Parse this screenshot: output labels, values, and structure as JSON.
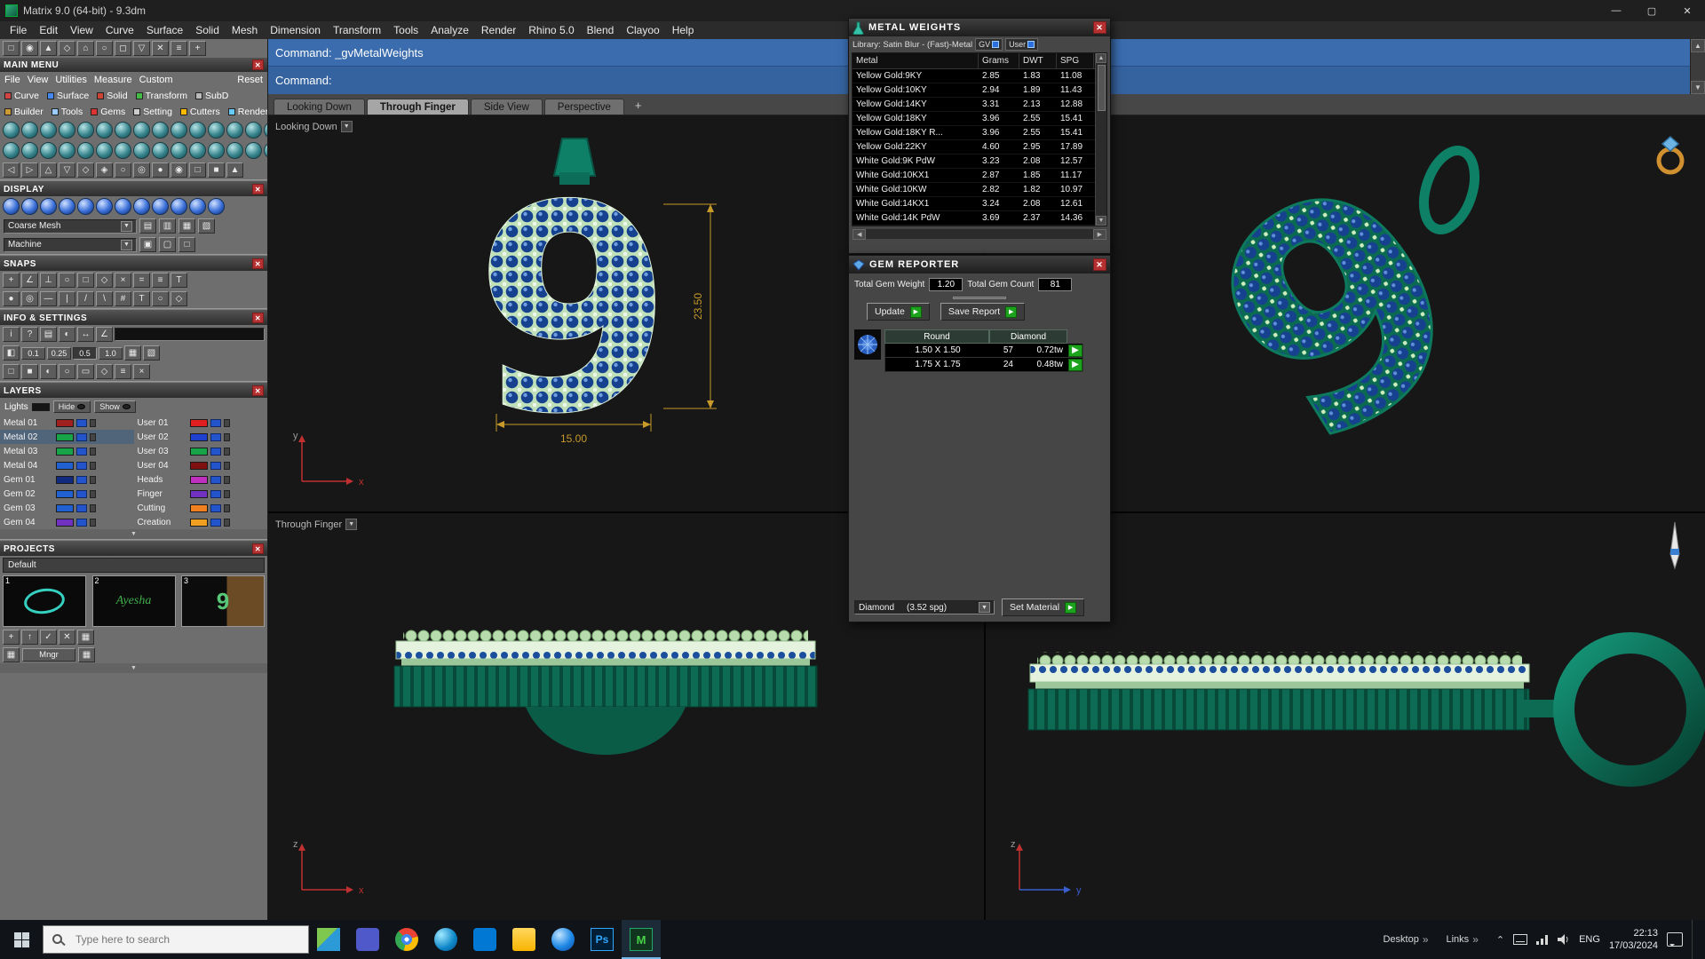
{
  "window": {
    "title": "Matrix 9.0 (64-bit) - 9.3dm"
  },
  "menu_bar": [
    "File",
    "Edit",
    "View",
    "Curve",
    "Surface",
    "Solid",
    "Mesh",
    "Dimension",
    "Transform",
    "Tools",
    "Analyze",
    "Render",
    "Rhino 5.0",
    "Blend",
    "Clayoo",
    "Help"
  ],
  "command": {
    "line1": "Command: _gvMetalWeights",
    "line2": "Command:"
  },
  "viewport_tabs": {
    "tabs": [
      "Looking Down",
      "Through Finger",
      "Side View",
      "Perspective"
    ],
    "active": "Through Finger"
  },
  "viewports": {
    "top_left": {
      "label": "Looking Down",
      "dim_height": "23.50",
      "dim_width": "15.00",
      "axes": [
        "y",
        "x"
      ]
    },
    "bottom_left": {
      "label": "Through Finger",
      "axes": [
        "z",
        "x"
      ]
    },
    "bottom_right": {
      "axes": [
        "z",
        "y"
      ]
    }
  },
  "left_panel": {
    "main_menu": {
      "title": "MAIN MENU",
      "menu_items": [
        "File",
        "View",
        "Utilities",
        "Measure",
        "Custom",
        "Reset"
      ],
      "shortcut_row1": [
        {
          "label": "Curve",
          "color": "#d04444"
        },
        {
          "label": "Surface",
          "color": "#4488ee"
        },
        {
          "label": "Solid",
          "color": "#cc4433"
        },
        {
          "label": "Transform",
          "color": "#44bb44"
        },
        {
          "label": "SubD",
          "color": "#bbbbbb"
        }
      ],
      "shortcut_row2": [
        {
          "label": "Builder",
          "color": "#cc9933"
        },
        {
          "label": "Tools",
          "color": "#99ccff"
        },
        {
          "label": "Gems",
          "color": "#dd3333"
        },
        {
          "label": "Setting",
          "color": "#cccccc"
        },
        {
          "label": "Cutters",
          "color": "#ffbb00"
        },
        {
          "label": "Render",
          "color": "#66ccff"
        }
      ]
    },
    "display": {
      "title": "DISPLAY",
      "mesh_dropdown": "Coarse Mesh",
      "machine_dropdown": "Machine"
    },
    "snaps": {
      "title": "SNAPS"
    },
    "info_settings": {
      "title": "INFO & SETTINGS",
      "snap_values": [
        "0.1",
        "0.25",
        "0.5",
        "1.0"
      ],
      "active_value": "0.5"
    },
    "layers": {
      "title": "LAYERS",
      "lights_label": "Lights",
      "hide_label": "Hide",
      "show_label": "Show",
      "selected": "Metal 02",
      "left": [
        {
          "label": "Metal 01",
          "color": "#a02020"
        },
        {
          "label": "Metal 02",
          "color": "#18a54a"
        },
        {
          "label": "Metal 03",
          "color": "#18a54a"
        },
        {
          "label": "Metal 04",
          "color": "#2060d0"
        },
        {
          "label": "Gem 01",
          "color": "#102a80"
        },
        {
          "label": "Gem 02",
          "color": "#2060d0"
        },
        {
          "label": "Gem 03",
          "color": "#2060d0"
        },
        {
          "label": "Gem 04",
          "color": "#7030c0"
        }
      ],
      "right": [
        {
          "label": "User 01",
          "color": "#e02020"
        },
        {
          "label": "User 02",
          "color": "#2040d0"
        },
        {
          "label": "User 03",
          "color": "#18a54a"
        },
        {
          "label": "User 04",
          "color": "#801010"
        },
        {
          "label": "Heads",
          "color": "#c030c0"
        },
        {
          "label": "Finger",
          "color": "#7030c0"
        },
        {
          "label": "Cutting",
          "color": "#f08020"
        },
        {
          "label": "Creation",
          "color": "#f0a020"
        }
      ]
    },
    "projects": {
      "title": "PROJECTS",
      "profile": "Default",
      "thumbs": [
        {
          "num": "1",
          "kind": "ellipse"
        },
        {
          "num": "2",
          "kind": "text",
          "text": "Ayesha"
        },
        {
          "num": "3",
          "kind": "pendant"
        }
      ],
      "mngr_label": "Mngr"
    }
  },
  "metal_weights": {
    "title": "METAL WEIGHTS",
    "library_label": "Library: Satin Blur - (Fast)-Metal",
    "gv_label": "GV",
    "user_label": "User",
    "columns": [
      "Metal",
      "Grams",
      "DWT",
      "SPG"
    ],
    "rows": [
      [
        "Yellow Gold:9KY",
        "2.85",
        "1.83",
        "11.08"
      ],
      [
        "Yellow Gold:10KY",
        "2.94",
        "1.89",
        "11.43"
      ],
      [
        "Yellow Gold:14KY",
        "3.31",
        "2.13",
        "12.88"
      ],
      [
        "Yellow Gold:18KY",
        "3.96",
        "2.55",
        "15.41"
      ],
      [
        "Yellow Gold:18KY R...",
        "3.96",
        "2.55",
        "15.41"
      ],
      [
        "Yellow Gold:22KY",
        "4.60",
        "2.95",
        "17.89"
      ],
      [
        "White Gold:9K PdW",
        "3.23",
        "2.08",
        "12.57"
      ],
      [
        "White Gold:10KX1",
        "2.87",
        "1.85",
        "11.17"
      ],
      [
        "White Gold:10KW",
        "2.82",
        "1.82",
        "10.97"
      ],
      [
        "White Gold:14KX1",
        "3.24",
        "2.08",
        "12.61"
      ],
      [
        "White Gold:14K PdW",
        "3.69",
        "2.37",
        "14.36"
      ]
    ]
  },
  "gem_reporter": {
    "title": "GEM REPORTER",
    "total_weight_label": "Total Gem Weight",
    "total_weight": "1.20",
    "total_count_label": "Total Gem Count",
    "total_count": "81",
    "update_label": "Update",
    "save_report_label": "Save Report",
    "columns": [
      "Round",
      "Diamond"
    ],
    "rows": [
      {
        "size": "1.50 X 1.50",
        "count": "57",
        "weight": "0.72tw"
      },
      {
        "size": "1.75 X 1.75",
        "count": "24",
        "weight": "0.48tw"
      }
    ],
    "material_name": "Diamond",
    "material_spg": "(3.52 spg)",
    "set_material_label": "Set Material"
  },
  "taskbar": {
    "search_placeholder": "Type here to search",
    "apps": [
      {
        "name": "photos"
      },
      {
        "name": "teams"
      },
      {
        "name": "chrome"
      },
      {
        "name": "edge"
      },
      {
        "name": "store"
      },
      {
        "name": "explorer"
      },
      {
        "name": "browser"
      },
      {
        "name": "photoshop",
        "label": "Ps"
      },
      {
        "name": "matrix",
        "label": "M",
        "active": true
      }
    ],
    "desktop_label": "Desktop",
    "links_label": "Links",
    "language": "ENG",
    "time": "22:13",
    "date": "17/03/2024"
  }
}
